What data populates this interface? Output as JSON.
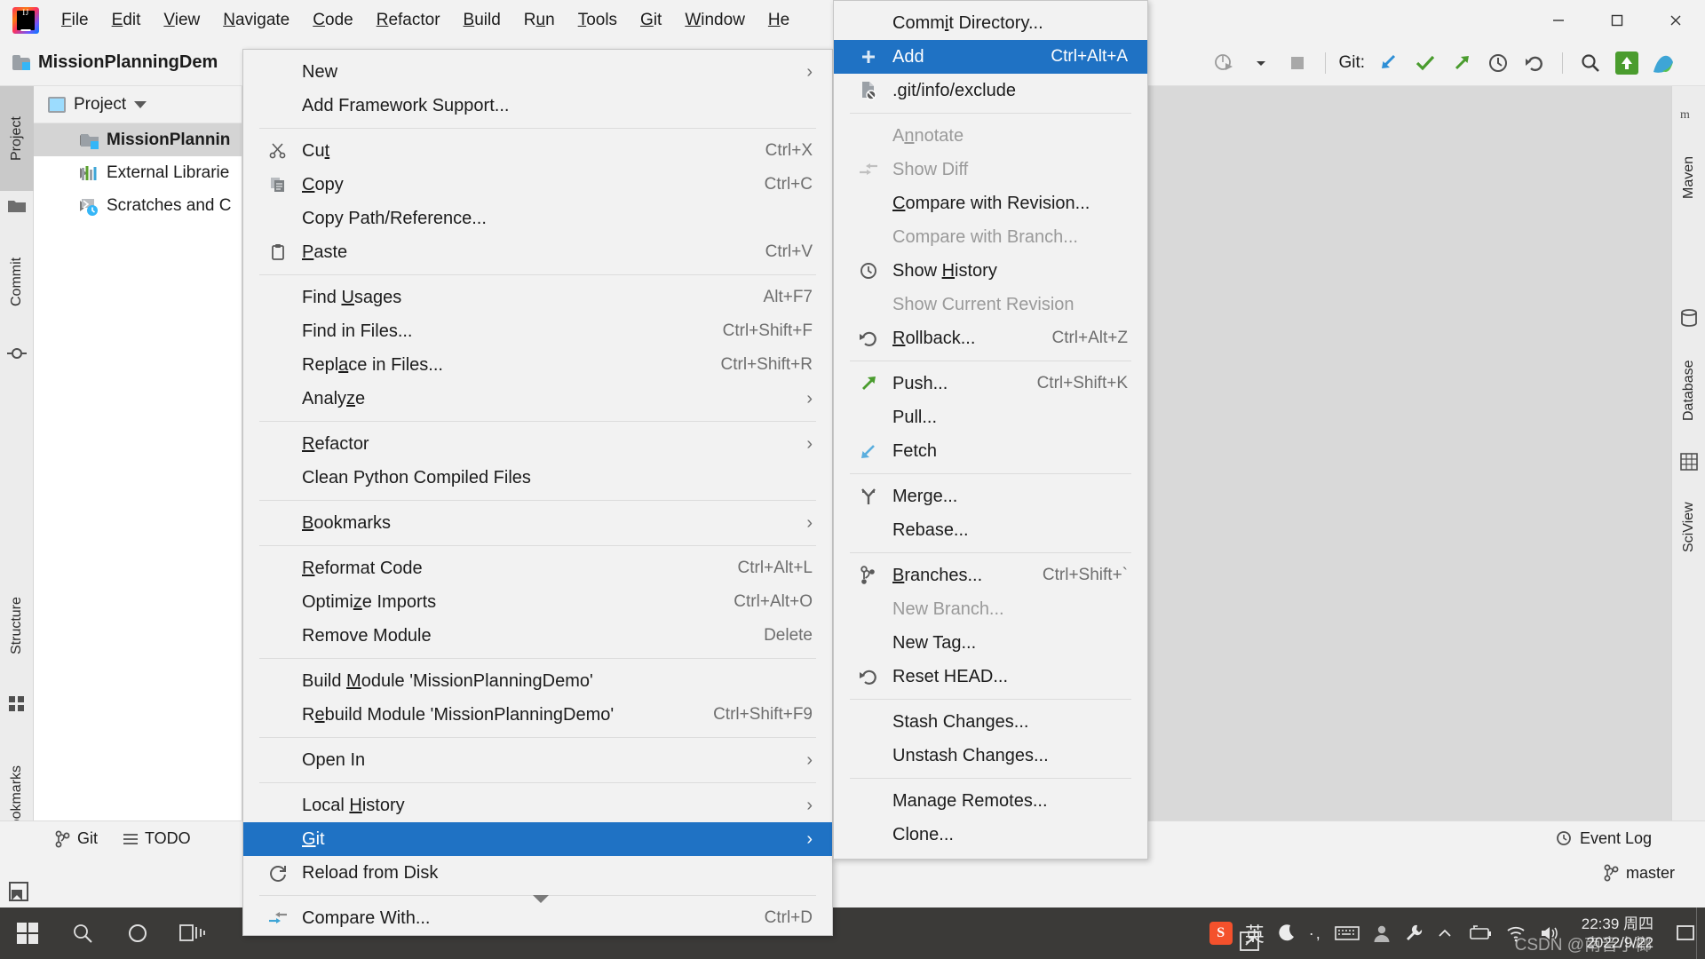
{
  "window": {
    "app": "IntelliJ IDEA",
    "project_title": "MissionPlanningDem",
    "minimize": "–",
    "maximize": "❐",
    "close": "✕"
  },
  "menubar": {
    "items": [
      {
        "label": "File",
        "mnemonic": "F"
      },
      {
        "label": "Edit",
        "mnemonic": "E"
      },
      {
        "label": "View",
        "mnemonic": "V"
      },
      {
        "label": "Navigate",
        "mnemonic": "N"
      },
      {
        "label": "Code",
        "mnemonic": "C"
      },
      {
        "label": "Refactor",
        "mnemonic": "R"
      },
      {
        "label": "Build",
        "mnemonic": "B"
      },
      {
        "label": "Run",
        "mnemonic": "u"
      },
      {
        "label": "Tools",
        "mnemonic": "T"
      },
      {
        "label": "Git",
        "mnemonic": "G"
      },
      {
        "label": "Window",
        "mnemonic": "W"
      },
      {
        "label": "He",
        "mnemonic": "H"
      }
    ]
  },
  "toolbar": {
    "git_label": "Git:",
    "icons": [
      "run-with-coverage-icon",
      "dropdown-arrow-icon",
      "stop-icon",
      "update-project-icon",
      "commit-icon",
      "push-icon",
      "history-icon",
      "rollback-icon",
      "search-everywhere-icon",
      "updates-icon",
      "ide-profile-icon"
    ]
  },
  "left_strip": {
    "tabs": [
      "Project",
      "Commit",
      "Structure",
      "Bookmarks"
    ]
  },
  "right_strip": {
    "tabs": [
      "Maven",
      "Database",
      "SciView"
    ]
  },
  "project_tool": {
    "header_label": "Project",
    "rows": [
      {
        "label": "MissionPlannin",
        "icon": "module-folder-icon",
        "selected": true
      },
      {
        "label": "External Librarie",
        "icon": "libraries-icon",
        "selected": false
      },
      {
        "label": "Scratches and C",
        "icon": "scratches-icon",
        "selected": false
      }
    ]
  },
  "context_menu": {
    "groups": [
      [
        {
          "label": "New",
          "mnemonic": "",
          "submenu": true,
          "icon": null
        },
        {
          "label": "Add Framework Support...",
          "submenu": false,
          "icon": null
        }
      ],
      [
        {
          "label": "Cut",
          "mnemonic": "t",
          "shortcut": "Ctrl+X",
          "icon": "scissors-icon"
        },
        {
          "label": "Copy",
          "mnemonic": "C",
          "shortcut": "Ctrl+C",
          "icon": "copy-icon"
        },
        {
          "label": "Copy Path/Reference...",
          "shortcut": "",
          "icon": null
        },
        {
          "label": "Paste",
          "mnemonic": "P",
          "shortcut": "Ctrl+V",
          "icon": "clipboard-icon"
        }
      ],
      [
        {
          "label": "Find Usages",
          "mnemonic": "U",
          "shortcut": "Alt+F7",
          "icon": null
        },
        {
          "label": "Find in Files...",
          "shortcut": "Ctrl+Shift+F",
          "icon": null
        },
        {
          "label": "Replace in Files...",
          "mnemonic": "a",
          "shortcut": "Ctrl+Shift+R",
          "icon": null
        },
        {
          "label": "Analyze",
          "mnemonic": "z",
          "submenu": true,
          "icon": null
        }
      ],
      [
        {
          "label": "Refactor",
          "mnemonic": "R",
          "submenu": true,
          "icon": null
        },
        {
          "label": "Clean Python Compiled Files",
          "icon": null
        }
      ],
      [
        {
          "label": "Bookmarks",
          "mnemonic": "B",
          "submenu": true,
          "icon": null
        }
      ],
      [
        {
          "label": "Reformat Code",
          "mnemonic": "R",
          "shortcut": "Ctrl+Alt+L",
          "icon": null
        },
        {
          "label": "Optimize Imports",
          "mnemonic": "z",
          "shortcut": "Ctrl+Alt+O",
          "icon": null
        },
        {
          "label": "Remove Module",
          "shortcut": "Delete",
          "icon": null
        }
      ],
      [
        {
          "label": "Build Module 'MissionPlanningDemo'",
          "mnemonic": "M",
          "icon": null
        },
        {
          "label": "Rebuild Module 'MissionPlanningDemo'",
          "mnemonic": "e",
          "shortcut": "Ctrl+Shift+F9",
          "icon": null
        }
      ],
      [
        {
          "label": "Open In",
          "submenu": true,
          "icon": null
        }
      ],
      [
        {
          "label": "Local History",
          "mnemonic": "H",
          "submenu": true,
          "icon": null
        },
        {
          "label": "Git",
          "mnemonic": "G",
          "submenu": true,
          "icon": null,
          "selected": true
        },
        {
          "label": "Reload from Disk",
          "icon": "reload-icon"
        }
      ],
      [
        {
          "label": "Compare With...",
          "shortcut": "Ctrl+D",
          "icon": "compare-icon",
          "submenu_arrow": true
        }
      ]
    ]
  },
  "git_submenu": {
    "groups": [
      [
        {
          "label": "Commit Directory...",
          "mnemonic": "i",
          "icon": null,
          "shortcut": ""
        },
        {
          "label": "Add",
          "shortcut": "Ctrl+Alt+A",
          "icon": "plus-icon",
          "selected": true
        },
        {
          "label": ".git/info/exclude",
          "icon": "exclude-file-icon",
          "shortcut": ""
        }
      ],
      [
        {
          "label": "Annotate",
          "mnemonic": "n",
          "icon": null,
          "disabled": true
        },
        {
          "label": "Show Diff",
          "icon": "show-diff-icon",
          "disabled": true
        },
        {
          "label": "Compare with Revision...",
          "mnemonic": "C",
          "icon": null
        },
        {
          "label": "Compare with Branch...",
          "icon": null,
          "disabled": true
        },
        {
          "label": "Show History",
          "mnemonic": "H",
          "icon": "clock-icon"
        },
        {
          "label": "Show Current Revision",
          "icon": null,
          "disabled": true
        },
        {
          "label": "Rollback...",
          "mnemonic": "R",
          "shortcut": "Ctrl+Alt+Z",
          "icon": "rollback-icon"
        }
      ],
      [
        {
          "label": "Push...",
          "shortcut": "Ctrl+Shift+K",
          "icon": "push-arrow-icon"
        },
        {
          "label": "Pull...",
          "icon": null
        },
        {
          "label": "Fetch",
          "icon": "fetch-arrow-icon"
        }
      ],
      [
        {
          "label": "Merge...",
          "icon": "merge-icon"
        },
        {
          "label": "Rebase...",
          "icon": null
        }
      ],
      [
        {
          "label": "Branches...",
          "mnemonic": "B",
          "shortcut": "Ctrl+Shift+`",
          "icon": "branch-icon"
        },
        {
          "label": "New Branch...",
          "icon": null,
          "disabled": true
        },
        {
          "label": "New Tag...",
          "icon": null
        },
        {
          "label": "Reset HEAD...",
          "icon": "reset-icon"
        }
      ],
      [
        {
          "label": "Stash Changes...",
          "icon": null
        },
        {
          "label": "Unstash Changes...",
          "icon": null
        }
      ],
      [
        {
          "label": "Manage Remotes...",
          "icon": null
        },
        {
          "label": "Clone...",
          "icon": null
        }
      ]
    ]
  },
  "statusbar": {
    "git_tab": "Git",
    "todo_tab": "TODO",
    "event_log": "Event Log",
    "branch": "master"
  },
  "taskbar": {
    "ime_label": "英",
    "time": "22:39 周四",
    "date": "2022/9/22",
    "watermark": "CSDN @南音小榔"
  },
  "colors": {
    "accent": "#1f72c4",
    "menu_bg": "#f2f2f2",
    "taskbar_bg": "#3b3a38",
    "editor_bg": "#d9d9d9"
  }
}
